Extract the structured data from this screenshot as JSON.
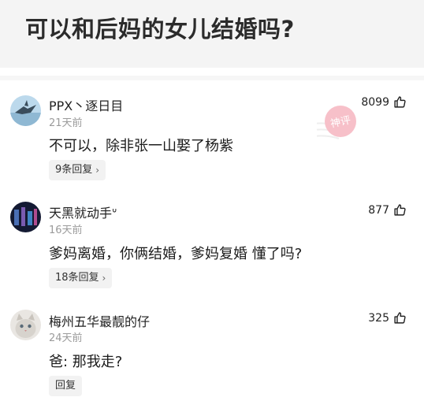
{
  "header": {
    "title": "可以和后妈的女儿结婚吗?"
  },
  "comments": [
    {
      "user": "PPX丶逐日目",
      "time": "21天前",
      "text": "不可以，除非张一山娶了杨紫",
      "reply_label": "9条回复",
      "likes": "8099",
      "badge": "神评"
    },
    {
      "user": "天黑就动手ᐡ",
      "time": "16天前",
      "text": "爹妈离婚，你俩结婚，爹妈复婚  懂了吗?",
      "reply_label": "18条回复",
      "likes": "877"
    },
    {
      "user": "梅州五华最靓的仔",
      "time": "24天前",
      "text": "爸: 那我走?",
      "reply_label": "回复",
      "likes": "325"
    }
  ]
}
